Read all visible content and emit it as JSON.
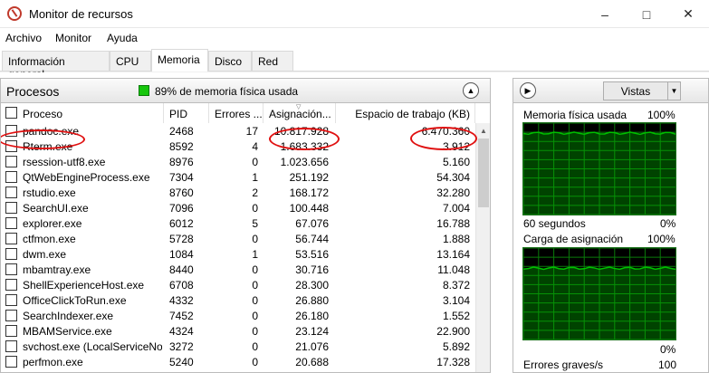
{
  "window": {
    "title": "Monitor de recursos"
  },
  "menu": {
    "items": [
      "Archivo",
      "Monitor",
      "Ayuda"
    ]
  },
  "tabs": [
    "Información general",
    "CPU",
    "Memoria",
    "Disco",
    "Red"
  ],
  "processes": {
    "title": "Procesos",
    "memory_status": "89% de memoria física usada",
    "columns": [
      "Proceso",
      "PID",
      "Errores ...",
      "Asignación...",
      "Espacio de trabajo (KB)"
    ],
    "rows": [
      [
        "pandoc.exe",
        "2468",
        "17",
        "10.817.928",
        "6.470.360"
      ],
      [
        "Rterm.exe",
        "8592",
        "4",
        "1.683.332",
        "3.912"
      ],
      [
        "rsession-utf8.exe",
        "8976",
        "0",
        "1.023.656",
        "5.160"
      ],
      [
        "QtWebEngineProcess.exe",
        "7304",
        "1",
        "251.192",
        "54.304"
      ],
      [
        "rstudio.exe",
        "8760",
        "2",
        "168.172",
        "32.280"
      ],
      [
        "SearchUI.exe",
        "7096",
        "0",
        "100.448",
        "7.004"
      ],
      [
        "explorer.exe",
        "6012",
        "5",
        "67.076",
        "16.788"
      ],
      [
        "ctfmon.exe",
        "5728",
        "0",
        "56.744",
        "1.888"
      ],
      [
        "dwm.exe",
        "1084",
        "1",
        "53.516",
        "13.164"
      ],
      [
        "mbamtray.exe",
        "8440",
        "0",
        "30.716",
        "11.048"
      ],
      [
        "ShellExperienceHost.exe",
        "6708",
        "0",
        "28.300",
        "8.372"
      ],
      [
        "OfficeClickToRun.exe",
        "4332",
        "0",
        "26.880",
        "3.104"
      ],
      [
        "SearchIndexer.exe",
        "7452",
        "0",
        "26.180",
        "1.552"
      ],
      [
        "MBAMService.exe",
        "4324",
        "0",
        "23.124",
        "22.900"
      ],
      [
        "svchost.exe (LocalServiceNo...",
        "3272",
        "0",
        "21.076",
        "5.892"
      ],
      [
        "perfmon.exe",
        "5240",
        "0",
        "20.688",
        "17.328"
      ]
    ]
  },
  "right_panel": {
    "views_label": "Vistas",
    "graphs": [
      {
        "title": "Memoria física usada",
        "max": "100%",
        "bottom_left": "60 segundos",
        "bottom_right": "0%",
        "level_percent": 89
      },
      {
        "title": "Carga de asignación",
        "max": "100%",
        "bottom_left": "",
        "bottom_right": "0%",
        "level_percent": 78
      }
    ],
    "third_label": "Errores graves/s",
    "third_max": "100"
  },
  "colors": {
    "graph_line": "#00c000",
    "graph_grid": "#0a7a0a",
    "annotation": "#e01010",
    "indicator": "#16c60c"
  },
  "icons": [
    "app-icon",
    "minimize-icon",
    "maximize-icon",
    "close-icon",
    "collapse-icon",
    "expand-icon",
    "chevron-down-icon"
  ]
}
